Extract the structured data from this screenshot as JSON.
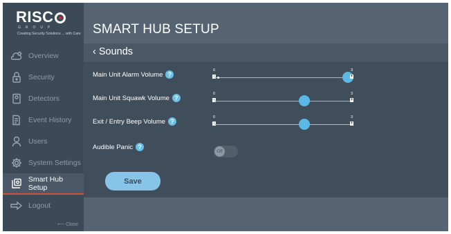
{
  "logo": {
    "name": "RISCO",
    "group": "GROUP",
    "tagline": "Creating Security Solutions ... with Care"
  },
  "sidebar": {
    "items": [
      {
        "label": "Overview",
        "icon": "cloud-sun-icon"
      },
      {
        "label": "Security",
        "icon": "lock-icon"
      },
      {
        "label": "Detectors",
        "icon": "detector-icon"
      },
      {
        "label": "Event History",
        "icon": "history-document-icon"
      },
      {
        "label": "Users",
        "icon": "user-icon"
      },
      {
        "label": "System Settings",
        "icon": "gear-icon"
      },
      {
        "label": "Smart Hub Setup",
        "icon": "smart-hub-icon",
        "active": true
      },
      {
        "label": "Logout",
        "icon": "logout-icon"
      }
    ],
    "close_label": "Close"
  },
  "header": {
    "title": "SMART HUB SETUP"
  },
  "subheader": {
    "back_label": "Sounds"
  },
  "settings": [
    {
      "label": "Main Unit Alarm Volume",
      "min_label": "0",
      "max_label": "3",
      "value": 3
    },
    {
      "label": "Main Unit Squawk Volume",
      "min_label": "0",
      "max_label": "3",
      "value": 2
    },
    {
      "label": "Exit / Entry Beep Volume",
      "min_label": "0",
      "max_label": "3",
      "value": 2
    }
  ],
  "audible_panic": {
    "label": "Audible Panic",
    "state": "Off"
  },
  "save_label": "Save",
  "colors": {
    "accent": "#5ab8e6",
    "active_underline": "#d0543b",
    "sidebar_bg": "#3c4a58"
  }
}
